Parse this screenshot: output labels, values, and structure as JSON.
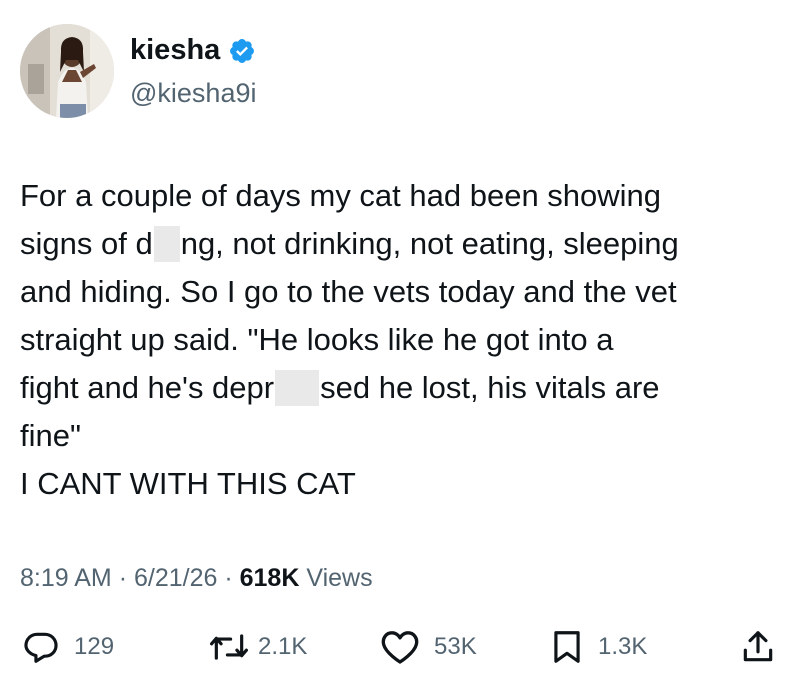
{
  "author": {
    "display_name": "kiesha",
    "handle": "@kiesha9i",
    "verified": true,
    "verified_color": "#1d9bf0"
  },
  "tweet": {
    "lines": {
      "l1": "For a couple of days my cat had been showing",
      "l2_a": "signs of d",
      "l2_b": "ng, not drinking, not eating, sleeping",
      "l3": "and hiding. So I go to the vets today and the vet",
      "l4": "straight up said. \"He looks like he got into a",
      "l5_a": "fight and he's depr",
      "l5_b": "sed he lost, his vitals are",
      "l6": "fine\"",
      "l7": "I CANT WITH THIS CAT"
    }
  },
  "meta": {
    "time": "8:19 AM",
    "separator": "·",
    "date": "6/21/26",
    "views_count": "618K",
    "views_label": "Views"
  },
  "actions": {
    "replies": "129",
    "reposts": "2.1K",
    "likes": "53K",
    "bookmarks": "1.3K"
  },
  "icons": {
    "reply": "reply-icon",
    "repost": "repost-icon",
    "like": "heart-icon",
    "bookmark": "bookmark-icon",
    "share": "share-icon",
    "verified": "verified-badge-icon"
  },
  "colors": {
    "text": "#0f1419",
    "secondary": "#536471",
    "accent": "#1d9bf0"
  }
}
